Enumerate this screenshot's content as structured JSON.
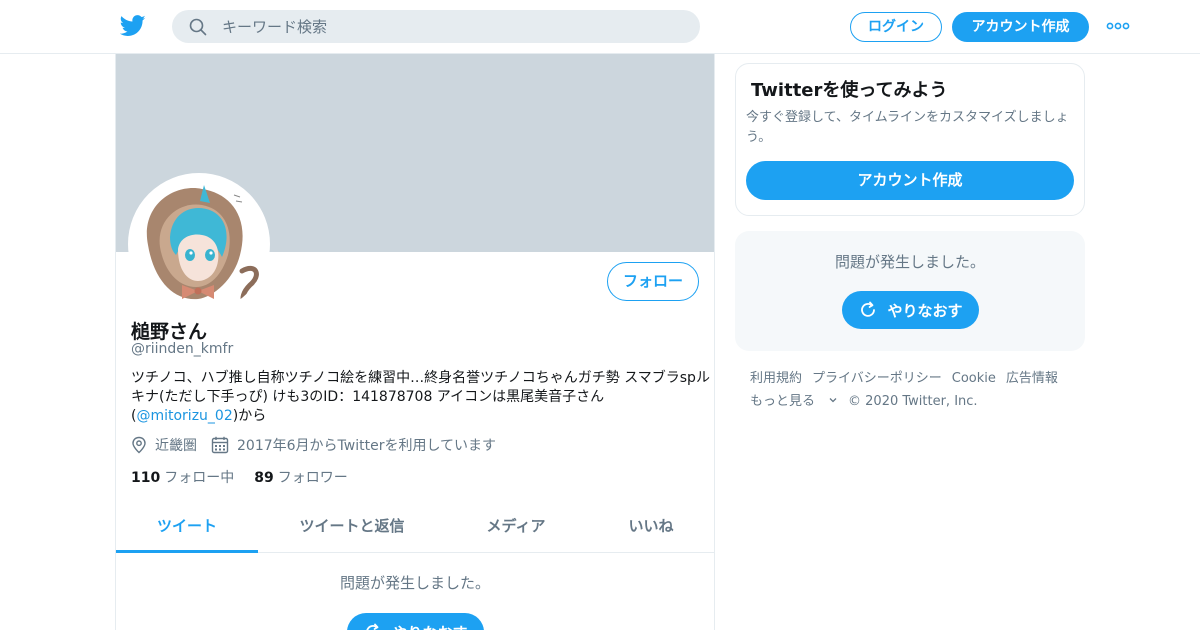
{
  "header": {
    "search_placeholder": "キーワード検索",
    "login_label": "ログイン",
    "signup_label": "アカウント作成"
  },
  "profile": {
    "display_name": "槌野さん",
    "handle": "@riinden_kmfr",
    "bio_text": "ツチノコ、ハブ推し自称ツチノコ絵を練習中…終身名誉ツチノコちゃんガチ勢 スマブラspルキナ(ただし下手っぴ) けも3のID：141878708 アイコンは黒尾美音子さん(",
    "bio_mention": "@mitorizu_02",
    "bio_suffix": ")から",
    "location": "近畿圏",
    "joined": "2017年6月からTwitterを利用しています",
    "following_count": "110",
    "following_label": "フォロー中",
    "followers_count": "89",
    "followers_label": "フォロワー",
    "follow_label": "フォロー"
  },
  "tabs": [
    {
      "label": "ツイート",
      "active": true
    },
    {
      "label": "ツイートと返信",
      "active": false
    },
    {
      "label": "メディア",
      "active": false
    },
    {
      "label": "いいね",
      "active": false
    }
  ],
  "main_error": {
    "message": "問題が発生しました。",
    "retry_label": "やりなおす"
  },
  "sidebar": {
    "promo_title": "Twitterを使ってみよう",
    "promo_text": "今すぐ登録して、タイムラインをカスタマイズしましょう。",
    "promo_button": "アカウント作成",
    "error_message": "問題が発生しました。",
    "retry_label": "やりなおす"
  },
  "footer": {
    "links": [
      "利用規約",
      "プライバシーポリシー",
      "Cookie",
      "広告情報",
      "もっと見る"
    ],
    "copyright": "© 2020 Twitter, Inc."
  },
  "colors": {
    "accent": "#1da1f2",
    "banner": "#ccd6dd",
    "muted_text": "#657786"
  }
}
